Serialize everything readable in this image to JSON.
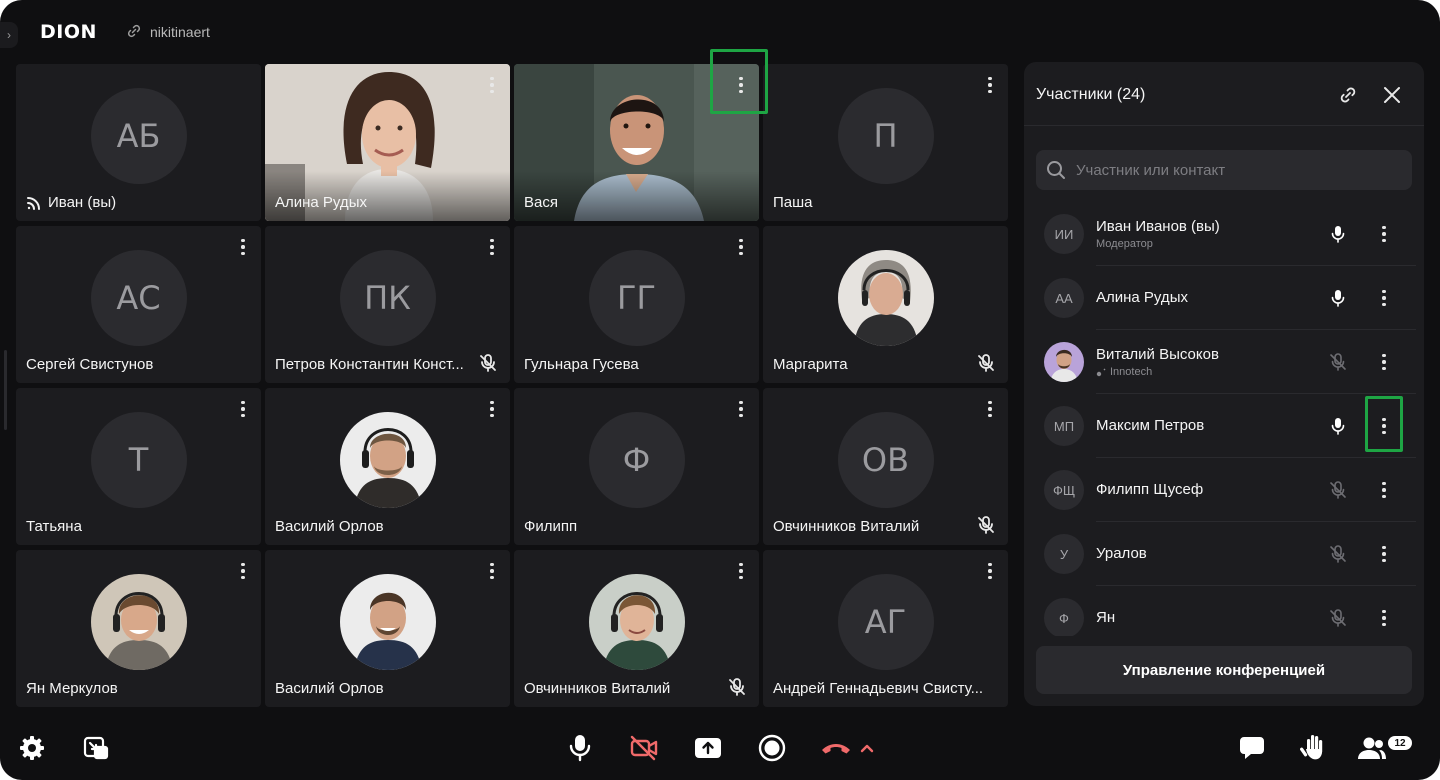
{
  "header": {
    "logo_text": "DION",
    "room_name": "nikitinaert"
  },
  "grid": {
    "tiles": [
      {
        "name": "Иван (вы)",
        "initials": "АБ",
        "speaking_icon": "broadcast-icon"
      },
      {
        "name": "Алина Рудых",
        "video": true
      },
      {
        "name": "Вася",
        "video": true
      },
      {
        "name": "Паша",
        "initials": "П"
      },
      {
        "name": "Сергей Свистунов",
        "initials": "АС"
      },
      {
        "name": "Петров Константин Конст...",
        "initials": "ПК",
        "muted": true
      },
      {
        "name": "Гульнара Гусева",
        "initials": "ГГ"
      },
      {
        "name": "Маргарита",
        "photo": true,
        "muted": true
      },
      {
        "name": "Татьяна",
        "initials": "Т"
      },
      {
        "name": "Василий Орлов",
        "photo": true
      },
      {
        "name": "Филипп",
        "initials": "Ф"
      },
      {
        "name": "Овчинников Виталий",
        "initials": "ОВ",
        "muted": true
      },
      {
        "name": "Ян Меркулов",
        "photo": true
      },
      {
        "name": "Василий Орлов",
        "photo": true
      },
      {
        "name": "Овчинников Виталий",
        "photo": true,
        "muted": true
      },
      {
        "name": "Андрей Геннадьевич Свисту...",
        "initials": "АГ"
      }
    ]
  },
  "panel": {
    "title": "Участники (24)",
    "search_placeholder": "Участник или контакт",
    "participants": [
      {
        "name": "Иван Иванов (вы)",
        "initials": "ИИ",
        "sub": "Модератор",
        "mic": "on"
      },
      {
        "name": "Алина Рудых",
        "initials": "АА",
        "mic": "on"
      },
      {
        "name": "Виталий Высоков",
        "photo": true,
        "sub": "Innotech",
        "mic": "off"
      },
      {
        "name": "Максим Петров",
        "initials": "МП",
        "mic": "on"
      },
      {
        "name": "Филипп Щусеф",
        "initials": "ФЩ",
        "mic": "off"
      },
      {
        "name": "Уралов",
        "initials": "У",
        "mic": "off"
      },
      {
        "name": "Ян",
        "initials": "Ф",
        "mic": "off"
      }
    ],
    "manage_button": "Управление конференцией"
  },
  "toolbar": {
    "participants_count": "12",
    "left": [
      "gear-icon",
      "picture-in-picture-icon"
    ],
    "center": [
      "microphone-icon",
      "camera-off-icon",
      "screen-share-icon",
      "record-icon",
      "hang-up-icon",
      "chevron-up-icon"
    ],
    "right": [
      "chat-icon",
      "raise-hand-icon",
      "participants-icon"
    ]
  },
  "colors": {
    "background": "#0f0f11",
    "tile": "#1c1c1f",
    "highlight": "#1ea544",
    "danger": "#f06a6a"
  }
}
